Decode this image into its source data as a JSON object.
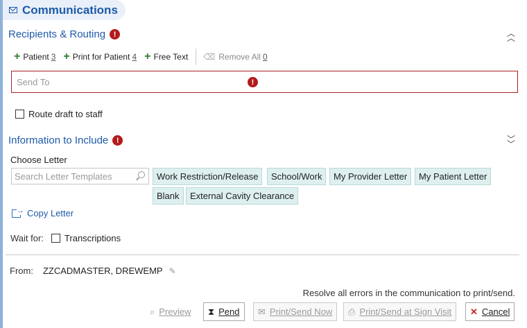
{
  "header": {
    "title": "Communications",
    "icon": "envelope-icon"
  },
  "recipients": {
    "title": "Recipients & Routing",
    "toolbar": {
      "patient": {
        "label": "Patient",
        "count": "3"
      },
      "print_for_patient": {
        "label": "Print for Patient",
        "count": "4"
      },
      "free_text": {
        "label": "Free Text"
      },
      "remove_all": {
        "label": "Remove All",
        "count": "0"
      }
    },
    "send_to_placeholder": "Send To",
    "route_draft_label": "Route draft to staff"
  },
  "information": {
    "title": "Information to Include",
    "choose_letter_label": "Choose Letter",
    "search_placeholder": "Search Letter Templates",
    "letters": [
      "Work Restriction/Release",
      "School/Work",
      "My Provider Letter",
      "My Patient Letter",
      "Blank",
      "External Cavity Clearance"
    ],
    "copy_letter_label": "Copy Letter",
    "wait_for_label": "Wait for:",
    "transcriptions_label": "Transcriptions"
  },
  "from": {
    "label": "From:",
    "value": "ZZCADMASTER, DREWEMP"
  },
  "resolve_message": "Resolve all errors in the communication to print/send.",
  "actions": {
    "preview": "Preview",
    "pend": "Pend",
    "print_send_now": "Print/Send Now",
    "print_send_sign_visit": "Print/Send at Sign Visit",
    "cancel": "Cancel"
  },
  "colors": {
    "accent": "#1e5aa8",
    "error": "#b31b1b",
    "chip": "#ddf0ef",
    "add": "#2e7d32"
  }
}
